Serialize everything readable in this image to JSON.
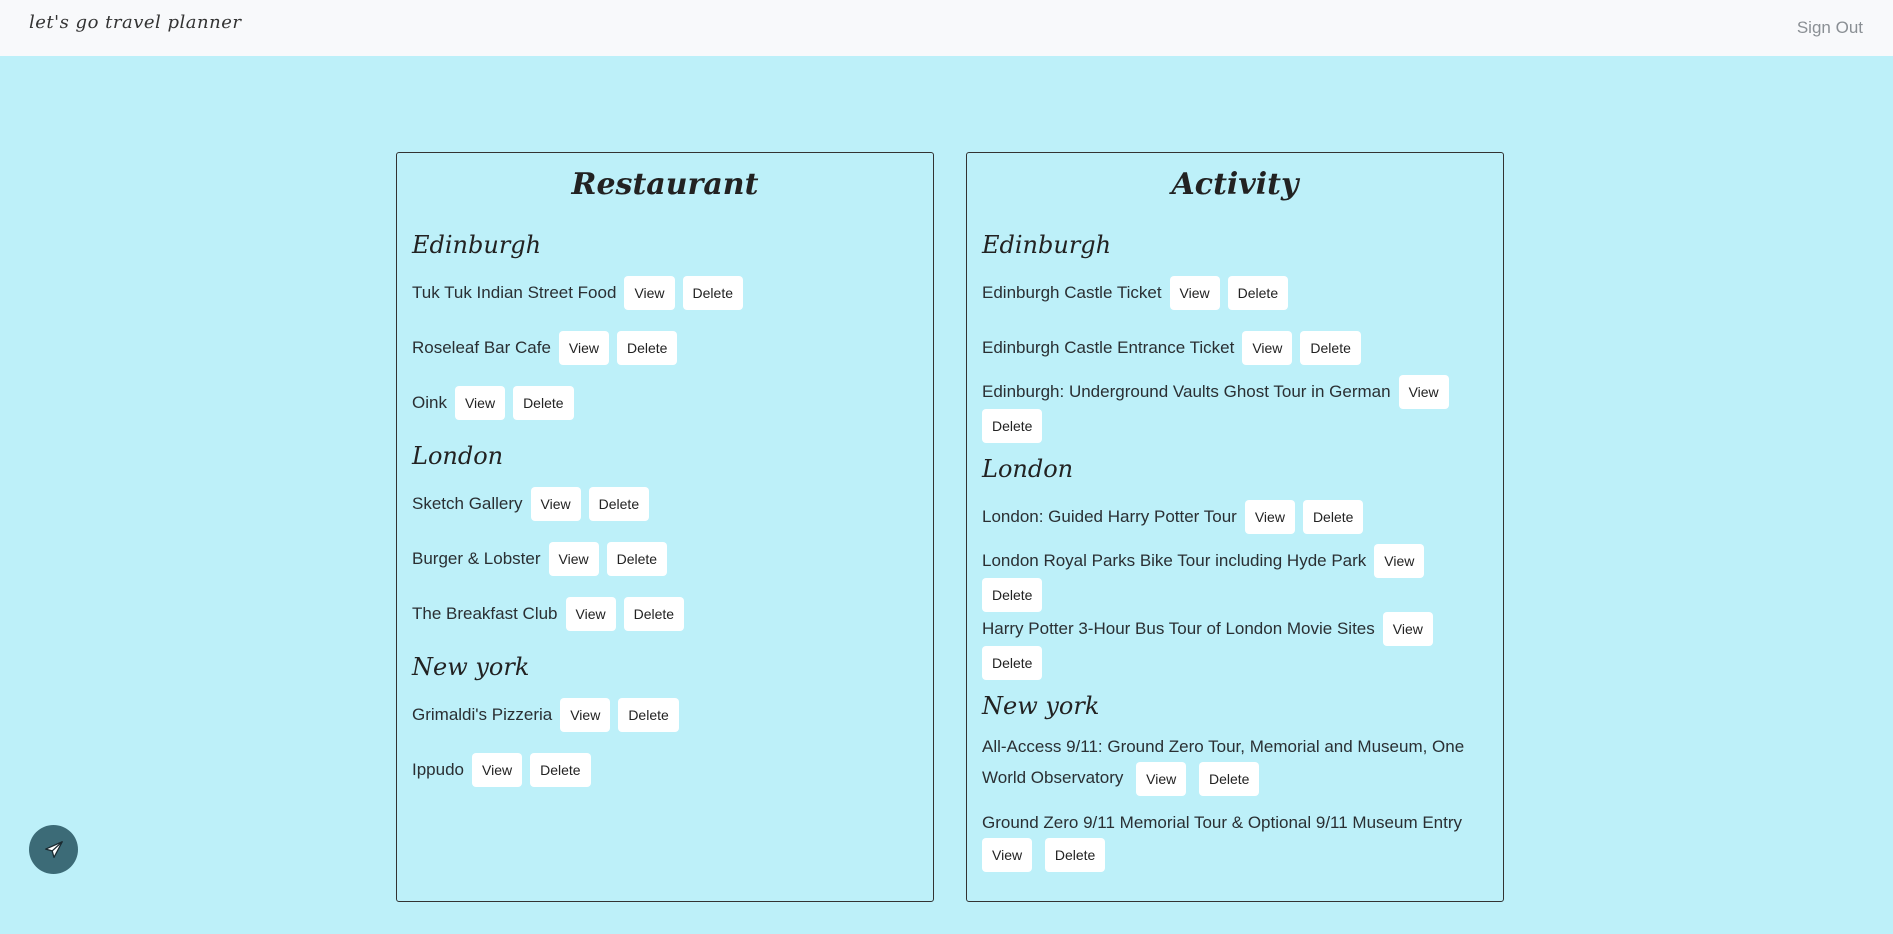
{
  "navbar": {
    "brand": "let's go travel planner",
    "signout": "Sign Out"
  },
  "colors": {
    "background": "#bdf0f9",
    "navbar": "#f8f9fb",
    "fab": "#3c6b77"
  },
  "fab_icon": "airplane-icon",
  "restaurant": {
    "title": "Restaurant",
    "groups": [
      {
        "city": "Edinburgh",
        "items": [
          "Tuk Tuk Indian Street Food",
          "Roseleaf Bar Cafe",
          "Oink"
        ]
      },
      {
        "city": "London",
        "items": [
          "Sketch Gallery",
          "Burger & Lobster",
          "The Breakfast Club"
        ]
      },
      {
        "city": "New york",
        "items": [
          "Grimaldi's Pizzeria",
          "Ippudo"
        ]
      }
    ]
  },
  "activity": {
    "title": "Activity",
    "groups": [
      {
        "city": "Edinburgh",
        "items": [
          "Edinburgh Castle Ticket",
          "Edinburgh Castle Entrance Ticket",
          "Edinburgh: Underground Vaults Ghost Tour in German"
        ]
      },
      {
        "city": "London",
        "items": [
          "London: Guided Harry Potter Tour",
          "London Royal Parks Bike Tour including Hyde Park",
          "Harry Potter 3-Hour Bus Tour of London Movie Sites"
        ]
      },
      {
        "city": "New york",
        "items": [
          "All-Access 9/11: Ground Zero Tour, Memorial and Museum, One World Observatory",
          "Ground Zero 9/11 Memorial Tour & Optional 9/11 Museum Entry"
        ]
      }
    ]
  },
  "buttons": {
    "view": "View",
    "delete": "Delete"
  }
}
